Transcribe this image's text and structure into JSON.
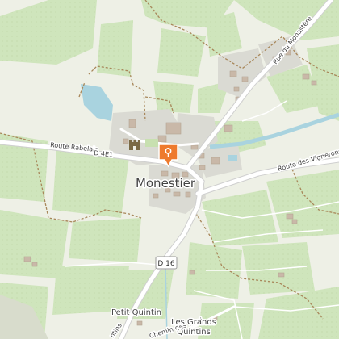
{
  "map": {
    "colors": {
      "background": "#eef0e6",
      "vineyard": "#cfe5bc",
      "vineyard_dark": "#c3dcae",
      "built": "#dadad3",
      "building": "#c9b8a8",
      "water": "#a9d3df",
      "road_major": "#ffffff",
      "road_casing": "#cfcfcf",
      "boundary": "#a8875a",
      "marker": "#ee7a2d"
    },
    "places": {
      "village": "Monestier",
      "hamlet_1": "Petit Quintin",
      "hamlet_2_line1": "Les Grands",
      "hamlet_2_line2": "Quintins"
    },
    "roads": {
      "rabelais": "Route Rabelais",
      "rabelais_ref": "D 4E1",
      "vignerons": "Route des Vignerons",
      "monastere": "Rue du Monastère",
      "chemin_partial": "Chemin des Verri",
      "d16": "D 16",
      "bottom_partial": "ntins"
    },
    "icons": {
      "marker": "map-pin-icon",
      "castle": "castle-icon"
    }
  }
}
